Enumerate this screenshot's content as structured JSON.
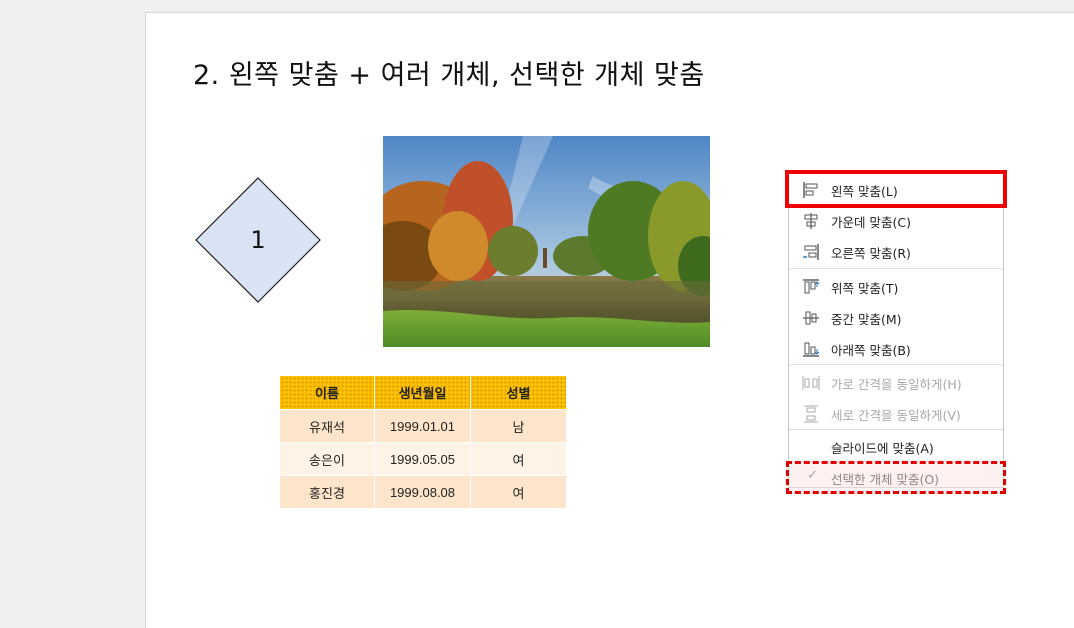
{
  "slide": {
    "title": "2. 왼쪽 맞춤 + 여러 개체, 선택한 개체 맞춤",
    "diamond_label": "1",
    "diamond_fill": "#dae3f3",
    "table": {
      "headers": [
        "이름",
        "생년월일",
        "성별"
      ],
      "rows": [
        [
          "유재석",
          "1999.01.01",
          "남"
        ],
        [
          "송은이",
          "1999.05.05",
          "여"
        ],
        [
          "홍진경",
          "1999.08.08",
          "여"
        ]
      ],
      "header_color": "#ffc000",
      "row_colors": [
        "#fde5cb",
        "#fef3e5"
      ]
    }
  },
  "menu": {
    "items": [
      {
        "label": "왼쪽 맞춤(L)",
        "icon": "align-left-icon"
      },
      {
        "label": "가운데 맞춤(C)",
        "icon": "align-center-icon"
      },
      {
        "label": "오른쪽 맞춤(R)",
        "icon": "align-right-icon"
      },
      {
        "label": "위쪽 맞춤(T)",
        "icon": "align-top-icon"
      },
      {
        "label": "중간 맞춤(M)",
        "icon": "align-middle-icon"
      },
      {
        "label": "아래쪽 맞춤(B)",
        "icon": "align-bottom-icon"
      },
      {
        "label": "가로 간격을 동일하게(H)",
        "icon": "distribute-horizontal-icon",
        "disabled": true
      },
      {
        "label": "세로 간격을 동일하게(V)",
        "icon": "distribute-vertical-icon",
        "disabled": true
      },
      {
        "label": "슬라이드에 맞춤(A)",
        "icon": ""
      },
      {
        "label": "선택한 개체 맞춤(O)",
        "icon": "check-icon",
        "checked": true
      }
    ],
    "highlight_color": "#ee0000"
  }
}
